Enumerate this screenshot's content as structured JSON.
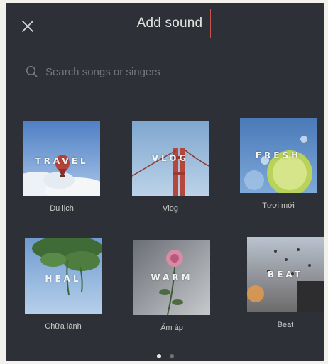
{
  "header": {
    "title": "Add sound",
    "close_icon": "close-icon"
  },
  "search": {
    "placeholder": "Search songs or singers",
    "value": "",
    "icon": "search-icon"
  },
  "categories": [
    {
      "word": "TRAVEL",
      "label": "Du lịch"
    },
    {
      "word": "VLOG",
      "label": "Vlog"
    },
    {
      "word": "FRESH",
      "label": "Tươi mới"
    },
    {
      "word": "HEAL",
      "label": "Chữa lành"
    },
    {
      "word": "WARM",
      "label": "Ấm áp"
    },
    {
      "word": "BEAT",
      "label": "Beat"
    }
  ],
  "pagination": {
    "pages": 2,
    "current": 1,
    "active_color": "#e6e6e6",
    "inactive_color": "#6e7177"
  },
  "colors": {
    "panel_background": "#2d3036",
    "title_border": "#c8534f"
  }
}
